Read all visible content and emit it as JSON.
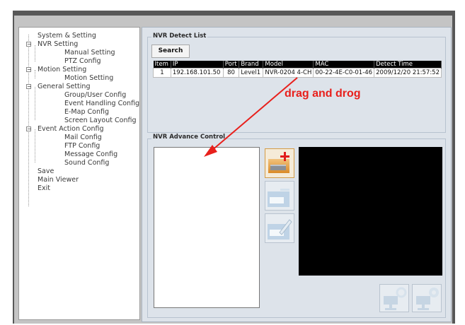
{
  "tree": {
    "items": [
      {
        "label": "System & Setting",
        "level": 0
      },
      {
        "label": "NVR  Setting",
        "level": 0
      },
      {
        "label": "Manual Setting",
        "level": 2
      },
      {
        "label": "PTZ Config",
        "level": 2
      },
      {
        "label": "Motion Setting",
        "level": 0
      },
      {
        "label": "Motion Setting",
        "level": 2
      },
      {
        "label": "General Setting",
        "level": 0
      },
      {
        "label": "Group/User Config",
        "level": 2
      },
      {
        "label": "Event Handling Config",
        "level": 2
      },
      {
        "label": "E-Map Config",
        "level": 2
      },
      {
        "label": "Screen Layout Config",
        "level": 2
      },
      {
        "label": "Event Action Config",
        "level": 0
      },
      {
        "label": "Mail Config",
        "level": 2
      },
      {
        "label": "FTP Config",
        "level": 2
      },
      {
        "label": "Message Config",
        "level": 2
      },
      {
        "label": "Sound Config",
        "level": 2
      },
      {
        "label": "Save",
        "level": 0
      },
      {
        "label": "Main Viewer",
        "level": 0
      },
      {
        "label": "Exit",
        "level": 0
      }
    ],
    "toggle_symbol": "−"
  },
  "detect": {
    "title": "NVR  Detect List",
    "search_label": "Search",
    "columns": [
      "Item",
      "IP",
      "Port",
      "Brand",
      "Model",
      "MAC",
      "Detect Time"
    ],
    "rows": [
      [
        "1",
        "192.168.101.50",
        "80",
        "Level1",
        "NVR-0204  4-CH",
        "00-22-4E-C0-01-46",
        "2009/12/20 21:57:52"
      ]
    ]
  },
  "annotation": "drag and drog",
  "advance": {
    "title": "NVR  Advance Control"
  },
  "icons": {
    "add": "add-nvr-icon",
    "remove": "remove-nvr-icon",
    "edit": "edit-nvr-icon",
    "cam_a": "camera-refresh-icon",
    "cam_b": "camera-settings-icon"
  },
  "colors": {
    "annotation": "#e8201c",
    "header": "#000000",
    "add_plus": "#e01b1b"
  }
}
